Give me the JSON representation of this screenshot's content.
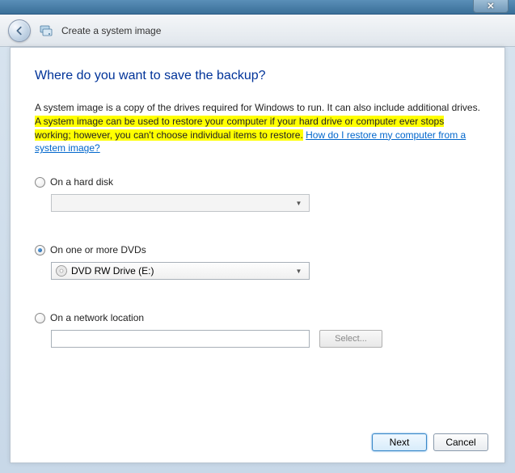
{
  "window": {
    "title": "Create a system image",
    "close_glyph": "✕"
  },
  "page": {
    "heading": "Where do you want to save the backup?",
    "desc_part1": "A system image is a copy of the drives required for Windows to run. It can also include additional drives. ",
    "desc_highlight": "A system image can be used to restore your computer if your hard drive or computer ever stops working; however, you can't choose individual items to restore.",
    "desc_part2": " ",
    "help_link": "How do I restore my computer from a system image?"
  },
  "options": {
    "hard_disk": {
      "label": "On a hard disk",
      "selected": false,
      "combo_value": ""
    },
    "dvd": {
      "label": "On one or more DVDs",
      "selected": true,
      "combo_value": "DVD RW Drive (E:)"
    },
    "network": {
      "label": "On a network location",
      "selected": false,
      "path_value": "",
      "select_button": "Select..."
    }
  },
  "footer": {
    "next": "Next",
    "cancel": "Cancel"
  }
}
